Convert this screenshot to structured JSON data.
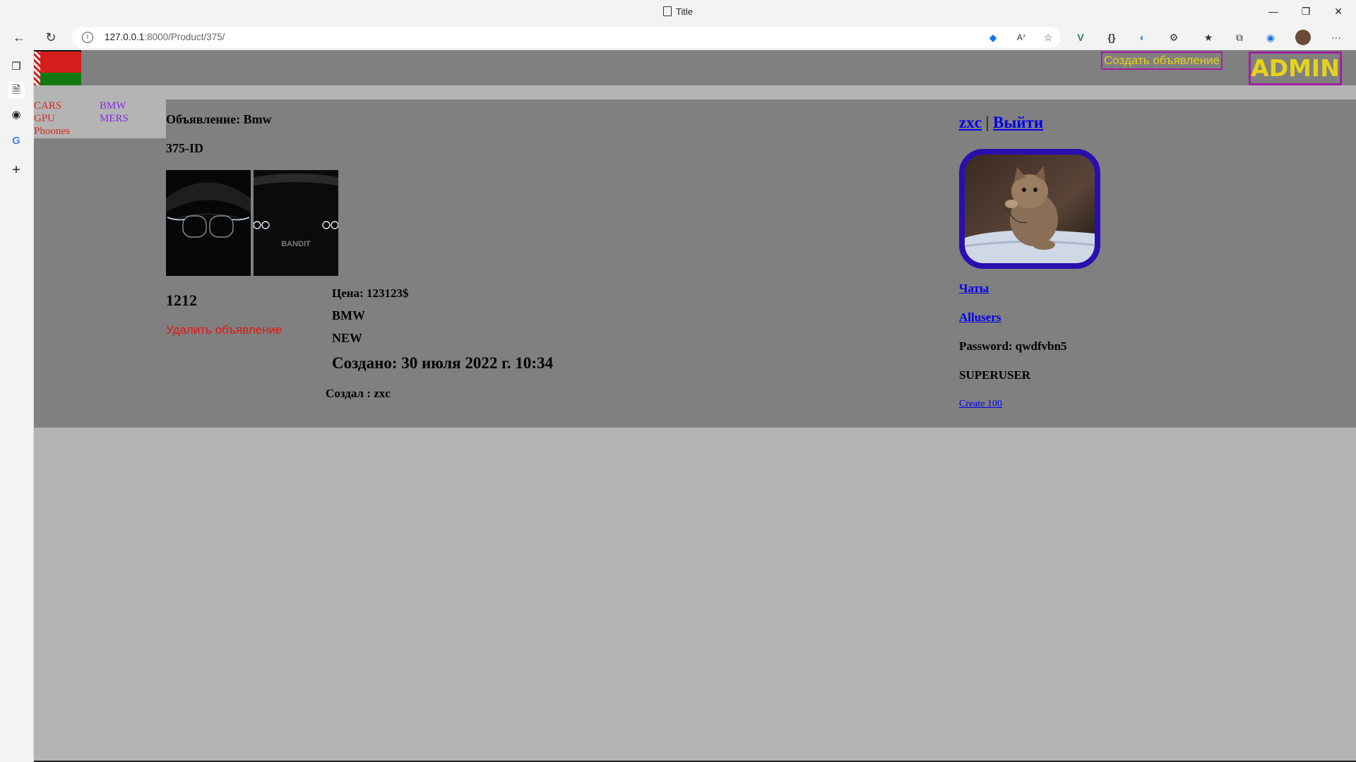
{
  "browser": {
    "tab_title": "Title",
    "url_host": "127.0.0.1",
    "url_rest": ":8000/Product/375/",
    "window_controls": [
      "minimize-icon",
      "restore-icon",
      "close-icon"
    ],
    "toolbar_icons": [
      "shield-tag-icon",
      "read-aloud-icon",
      "favorite-add-icon",
      "vue-devtools-icon",
      "json-icon",
      "translate-icon",
      "extensions-icon",
      "favorites-icon",
      "collections-icon",
      "edge-icon",
      "profile-avatar-icon",
      "more-icon"
    ],
    "sidebar_icons": [
      "tabs-icon",
      "page-icon",
      "github-icon",
      "google-icon",
      "add-icon"
    ]
  },
  "header": {
    "create_ad": "Создать объявление",
    "admin": "ADMIN",
    "accent_border": "#a020a0",
    "accent_text": "#e6d21a"
  },
  "nav": {
    "categories": [
      "CARS",
      "GPU",
      "Phoones"
    ],
    "brands": [
      "BMW",
      "MERS"
    ],
    "category_color": "#d52b1e",
    "brand_color": "#8a2be2"
  },
  "listing": {
    "heading": "Объявление: Bmw",
    "id_label": "375-ID",
    "images": [
      "bmw-front-headlights",
      "bmw-bandit-grille"
    ],
    "image_caption_text": "BANDIT",
    "title": "1212",
    "delete_label": "Удалить объявление",
    "price": "Цена: 123123$",
    "brand": "BMW",
    "condition": "NEW",
    "created": "Создано: 30 июля 2022 г. 10:34",
    "creator": "Создал : zxc"
  },
  "user_panel": {
    "username": "zxc",
    "separator": "|",
    "logout": "Выйти",
    "avatar": "kitten-photo",
    "chats": "Чаты",
    "allusers": "Allusers",
    "password": "Password: qwdfvbn5",
    "role": "SUPERUSER",
    "create100": "Create 100",
    "avatar_border": "#2a0fb0"
  }
}
